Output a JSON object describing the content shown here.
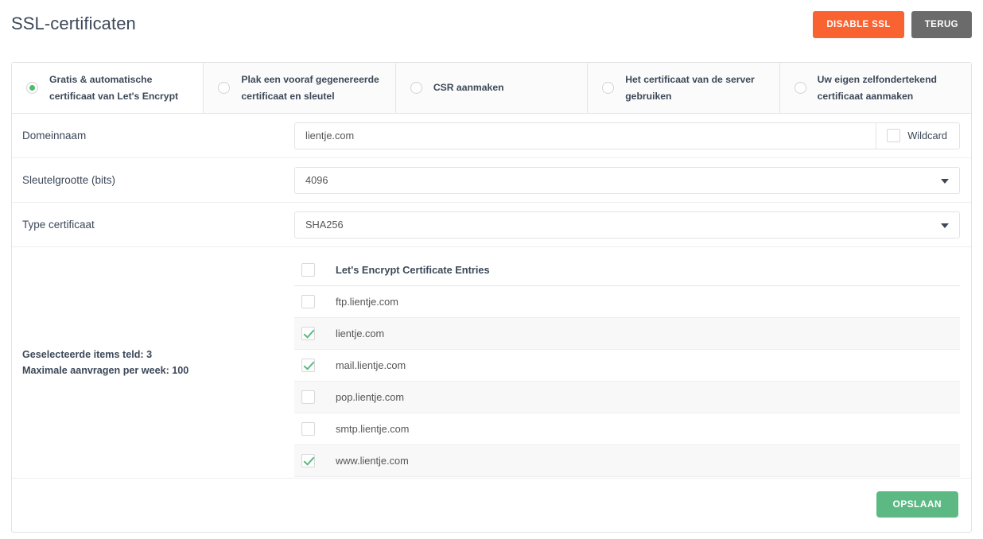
{
  "header": {
    "title": "SSL-certificaten",
    "disable_ssl_label": "DISABLE SSL",
    "back_label": "TERUG",
    "orange": "#f96332",
    "gray": "#6b6b6b"
  },
  "tabs": [
    {
      "label": "Gratis & automatische certificaat van Let's Encrypt",
      "selected": true
    },
    {
      "label": "Plak een vooraf gegenereerde certificaat en sleutel",
      "selected": false
    },
    {
      "label": "CSR aanmaken",
      "selected": false
    },
    {
      "label": "Het certificaat van de server gebruiken",
      "selected": false
    },
    {
      "label": "Uw eigen zelfondertekend certificaat aanmaken",
      "selected": false
    }
  ],
  "form": {
    "domain": {
      "label": "Domeinnaam",
      "value": "lientje.com",
      "placeholder": "",
      "wildcard_label": "Wildcard",
      "wildcard_checked": false
    },
    "keysize": {
      "label": "Sleutelgrootte (bits)",
      "value": "4096"
    },
    "certtype": {
      "label": "Type certificaat",
      "value": "SHA256"
    }
  },
  "entries": {
    "summary_selected": "Geselecteerde items teld: 3",
    "summary_max": "Maximale aanvragen per week: 100",
    "header_label": "Let's Encrypt Certificate Entries",
    "header_checked": false,
    "rows": [
      {
        "label": "ftp.lientje.com",
        "checked": false,
        "striped": false
      },
      {
        "label": "lientje.com",
        "checked": true,
        "striped": true
      },
      {
        "label": "mail.lientje.com",
        "checked": true,
        "striped": false
      },
      {
        "label": "pop.lientje.com",
        "checked": false,
        "striped": true
      },
      {
        "label": "smtp.lientje.com",
        "checked": false,
        "striped": false
      },
      {
        "label": "www.lientje.com",
        "checked": true,
        "striped": true
      }
    ]
  },
  "footer": {
    "save_label": "OPSLAAN",
    "green": "#5cb983"
  }
}
